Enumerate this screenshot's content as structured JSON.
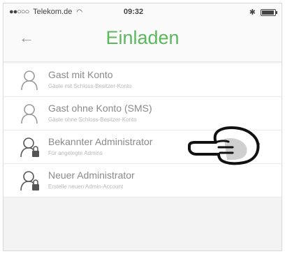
{
  "statusbar": {
    "carrier": "Telekom.de",
    "time": "09:32",
    "signal_icon": "signal-dots-icon",
    "wifi_icon": "wifi-icon",
    "bluetooth_icon": "bluetooth-icon",
    "battery_icon": "battery-icon"
  },
  "navbar": {
    "back_icon": "back-arrow-icon",
    "back_glyph": "←",
    "title": "Einladen",
    "title_color": "#5cb85c"
  },
  "options": [
    {
      "label": "Gast mit Konto",
      "sublabel": "Gäste mit Schloss-Besitzer-Konto",
      "icon": "person-icon",
      "selected": false
    },
    {
      "label": "Gast ohne Konto (SMS)",
      "sublabel": "Gäste ohne Schloss-Besitzer-Konto",
      "icon": "person-icon",
      "selected": false
    },
    {
      "label": "Bekannter Administrator",
      "sublabel": "Für angelegte Admins",
      "icon": "admin-person-icon",
      "selected": true,
      "check_glyph": "✓"
    },
    {
      "label": "Neuer Administrator",
      "sublabel": "Erstelle neuen Admin-Account",
      "icon": "admin-person-icon",
      "selected": false
    }
  ],
  "overlay": {
    "icon": "pointing-hand-icon"
  }
}
